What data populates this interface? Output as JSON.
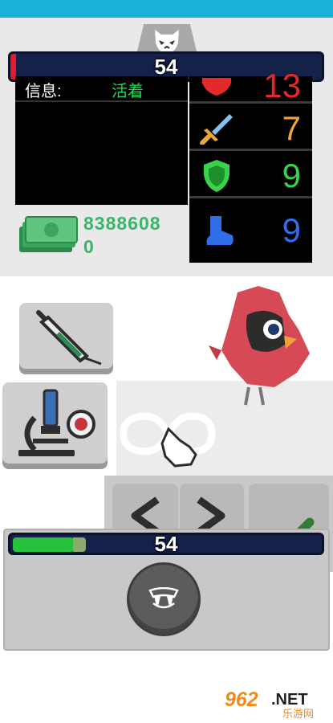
{
  "top_bar": {
    "value": "54"
  },
  "info": {
    "label": "信息:",
    "status": "活着"
  },
  "stats": [
    {
      "name": "health",
      "value": "13",
      "color": "#e32a2a",
      "icon": "heart-shield-icon"
    },
    {
      "name": "attack",
      "value": "7",
      "color": "#f0a336",
      "icon": "sword-icon"
    },
    {
      "name": "defense",
      "value": "9",
      "color": "#39d24a",
      "icon": "shield-icon"
    },
    {
      "name": "speed",
      "value": "9",
      "color": "#2f6ee8",
      "icon": "boot-icon"
    }
  ],
  "money": {
    "line1": "8388608",
    "line2": "0"
  },
  "tools": {
    "syringe": "syringe-icon",
    "microscope": "microscope-icon"
  },
  "creature": {
    "icon": "red-bird-creature"
  },
  "gesture": {
    "icon": "swipe-infinity-icon"
  },
  "bottom_bar": {
    "value": "54",
    "fill_fraction": 0.24
  },
  "action": {
    "icon": "fangs-icon"
  },
  "watermark": {
    "brand": "962.NET",
    "sub": "乐游网"
  },
  "colors": {
    "bar_bg": "#16214a",
    "panel_bg": "#e9e9e9",
    "hp_green": "#27c23d"
  }
}
